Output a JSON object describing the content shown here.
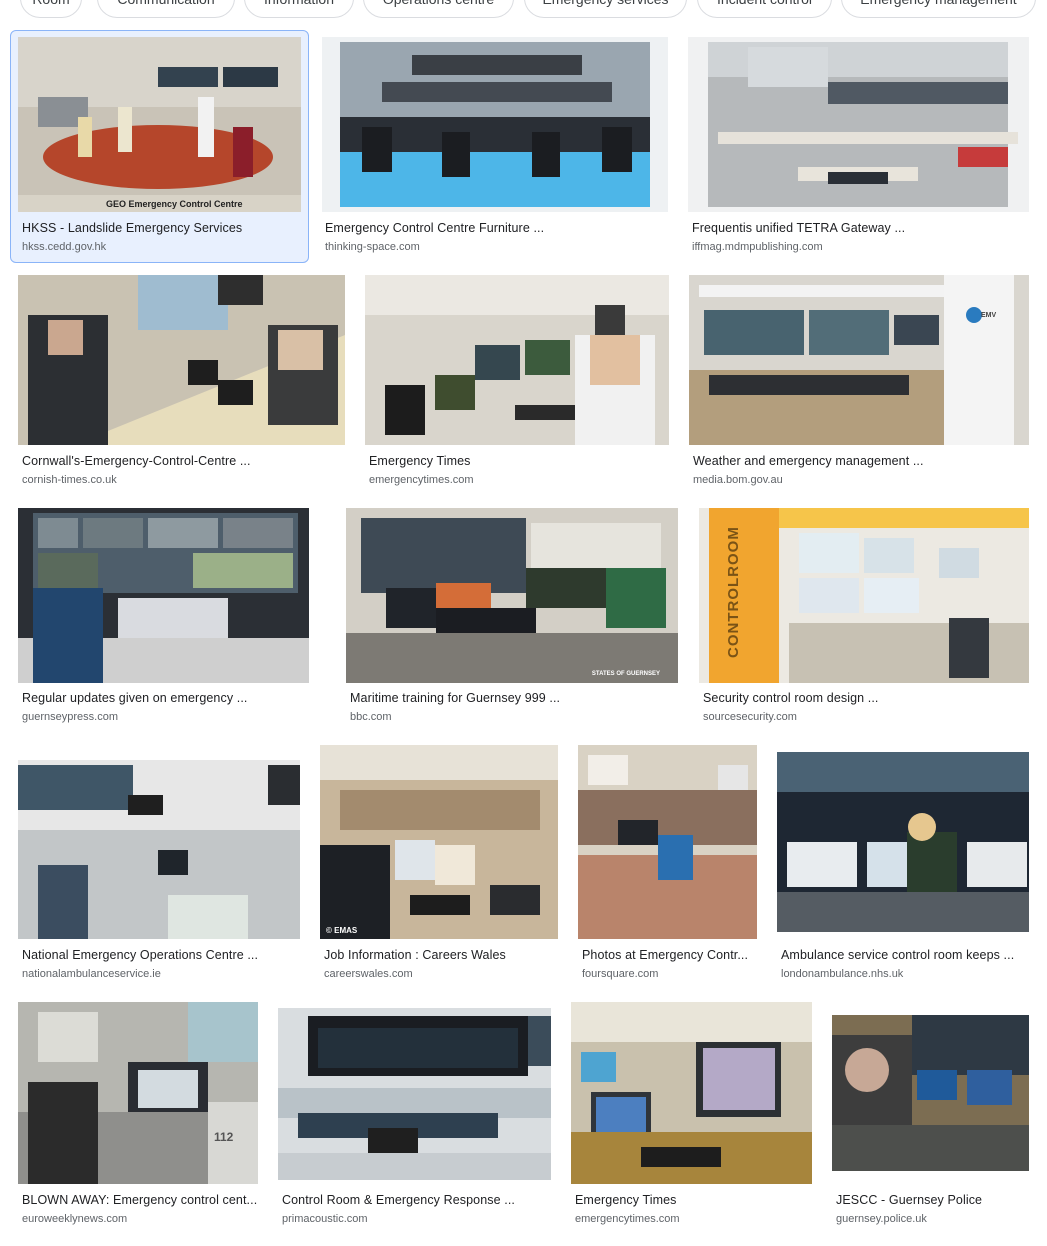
{
  "chips": [
    "Room",
    "Communication",
    "Information",
    "Operations centre",
    "Emergency services",
    "Incident control",
    "Emergency management"
  ],
  "results": [
    {
      "title": "HKSS - Landslide Emergency Services",
      "source": "hkss.cedd.gov.hk",
      "caption": "GEO Emergency Control Centre",
      "selected": true
    },
    {
      "title": "Emergency Control Centre Furniture ...",
      "source": "thinking-space.com"
    },
    {
      "title": "Frequentis unified TETRA Gateway ...",
      "source": "iffmag.mdmpublishing.com"
    },
    {
      "title": "Cornwall's-Emergency-Control-Centre ...",
      "source": "cornish-times.co.uk"
    },
    {
      "title": "Emergency Times",
      "source": "emergencytimes.com"
    },
    {
      "title": "Weather and emergency management ...",
      "source": "media.bom.gov.au",
      "logo_text": "EMV"
    },
    {
      "title": "Regular updates given on emergency ...",
      "source": "guernseypress.com"
    },
    {
      "title": "Maritime training for Guernsey 999 ...",
      "source": "bbc.com",
      "watermark": "STATES OF GUERNSEY"
    },
    {
      "title": "Security control room design ...",
      "source": "sourcesecurity.com",
      "wall_text": "CONTROLROOM"
    },
    {
      "title": "National Emergency Operations Centre ...",
      "source": "nationalambulanceservice.ie"
    },
    {
      "title": "Job Information : Careers Wales",
      "source": "careerswales.com",
      "watermark": "© EMAS"
    },
    {
      "title": "Photos at Emergency Contr...",
      "source": "foursquare.com"
    },
    {
      "title": "Ambulance service control room keeps ...",
      "source": "londonambulance.nhs.uk"
    },
    {
      "title": "BLOWN AWAY: Emergency control cent...",
      "source": "euroweeklynews.com",
      "panel_text": "112"
    },
    {
      "title": "Control Room & Emergency Response ...",
      "source": "primacoustic.com"
    },
    {
      "title": "Emergency Times",
      "source": "emergencytimes.com"
    },
    {
      "title": "JESCC - Guernsey Police",
      "source": "guernsey.police.uk"
    }
  ]
}
